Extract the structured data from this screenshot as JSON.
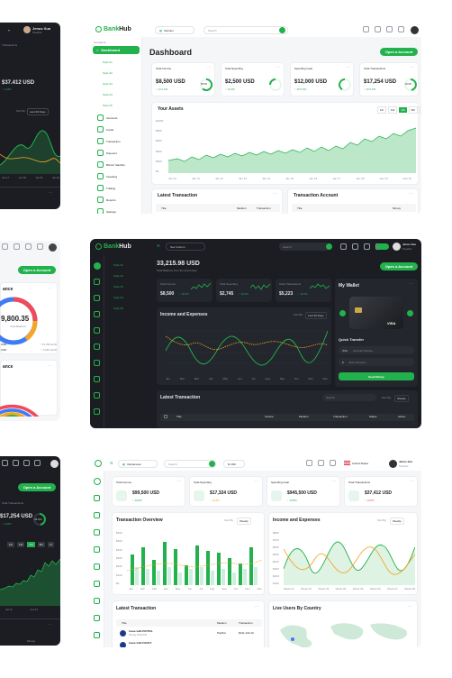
{
  "colors": {
    "accent": "#22b14c",
    "dark_bg": "#1b1d22",
    "dark_panel": "#23262c",
    "light_bg": "#f5f6f8",
    "orange": "#f5a623",
    "blue": "#3f7cf4",
    "red": "#ef4b5a"
  },
  "brand": {
    "bank": "Bank",
    "hub": "Hub"
  },
  "user": {
    "name": "Jenus Xea",
    "role": "Teacher",
    "short_name": "Jenus Xua"
  },
  "tl": {
    "amount": "$37.412 USD",
    "delta": "↑ 14.8%",
    "sort": "Sort By:",
    "sort_value": "Last 30 Days",
    "x_labels": [
      "Jul 17",
      "Jul 18",
      "Jul 19",
      "Jul 20"
    ]
  },
  "ml": {
    "open_account": "Open a Account",
    "balance_title": "ance",
    "balance_value": "9,800.35",
    "balance_caption": "Total Balance",
    "legend": [
      {
        "label": "USD",
        "value": "↑ 15,235 EUR"
      },
      {
        "label": "USD",
        "value": "↑ 14,8% EUR"
      }
    ],
    "second_title": "ance"
  },
  "bl": {
    "stat_title": "Total Transactions",
    "stat_value": "$17,254 USD",
    "stat_delta": "↑ 14.8%",
    "percent": "46.5%",
    "open_account": "Open a Account",
    "ranges": [
      "1D",
      "1W",
      "1M",
      "3M",
      "1Y"
    ],
    "x_labels": [
      "Jul 11",
      "Jul 14"
    ],
    "footer": "Money"
  },
  "d1": {
    "search_placeholder": "Search",
    "lang": "Vietnam",
    "nav_title": "Navigation",
    "nav": [
      {
        "label": "Dashboard"
      },
      {
        "label": "Style 01"
      },
      {
        "label": "Style 02"
      },
      {
        "label": "Style 03"
      },
      {
        "label": "Style 04"
      },
      {
        "label": "Style 05"
      },
      {
        "label": "Accounts"
      },
      {
        "label": "Cards"
      },
      {
        "label": "Transaction"
      },
      {
        "label": "Payment"
      },
      {
        "label": "Bitcoin Stanbits"
      },
      {
        "label": "Investing"
      },
      {
        "label": "Trading"
      },
      {
        "label": "Reports"
      },
      {
        "label": "Settings"
      }
    ],
    "title": "Dashboard",
    "open_account": "Open a Account",
    "stats": [
      {
        "title": "Total Income",
        "value": "$8,500 USD",
        "delta": "↑ 14.2 MV",
        "pct": "58.5%"
      },
      {
        "title": "Total Spending",
        "value": "$2,500 USD",
        "delta": "↑ 12 MV",
        "pct": ""
      },
      {
        "title": "Spending Goal",
        "value": "$12,000 USD",
        "delta": "↑ 15.6 MV",
        "pct": ""
      },
      {
        "title": "Total Transactions",
        "value": "$17,254 USD",
        "delta": "↑ 16.5 MV",
        "pct": "46.5%"
      }
    ],
    "assets_title": "Your Assets",
    "ranges": [
      "1D",
      "1W",
      "1M",
      "3M",
      "1Y"
    ],
    "y_labels": [
      "$1000",
      "$800",
      "$600",
      "$400",
      "$200",
      "$0"
    ],
    "x_labels": [
      "Jan 10",
      "Jan 11",
      "Jan 12",
      "Jan 13",
      "Jan 14",
      "Jan 15",
      "Jan 16",
      "Jan 17",
      "Jan 18",
      "Jan 19",
      "Feb 10"
    ],
    "latest_title": "Latest Transaction",
    "account_title": "Transaction Account",
    "cols": [
      "Title",
      "Medium",
      "Transaction"
    ],
    "cols2": [
      "Title",
      "Money"
    ]
  },
  "d2": {
    "brand_bank": "Bank",
    "brand_hub": "Hub",
    "menu": "Nav Column",
    "search": "Search",
    "nav": [
      "Style 01",
      "Style 02",
      "Style 03",
      "Style 04",
      "Style 05"
    ],
    "balance": "33,215.98 USD",
    "balance_caption": "Total Balance from the account(s)",
    "open_account": "Open a Account",
    "stats": [
      {
        "title": "Total Income",
        "value": "$8,500",
        "delta": "↑ 10.2%"
      },
      {
        "title": "Total Spending",
        "value": "$2,745",
        "delta": "↑ 10.2%"
      },
      {
        "title": "Total Transactions",
        "value": "$5,223",
        "delta": "↑ 10.2%"
      }
    ],
    "ie_title": "Income and Expenses",
    "ie_sort": "Sort By:",
    "ie_sort_value": "Last 30 Days",
    "x_labels": [
      "Jan",
      "Feb",
      "Mar",
      "Apr",
      "May",
      "Jun",
      "Jul",
      "Aug",
      "Sep",
      "Oct",
      "Nov",
      "Dec"
    ],
    "wallet_title": "My Wallet",
    "card_text": "VISA",
    "quick_title": "Quick Transfer",
    "quick_to": "Who",
    "quick_to_ph": "Account Numbe...",
    "quick_amount": "$",
    "quick_amount_ph": "Enter Amount...",
    "send": "Send Money",
    "latest_title": "Latest Transaction",
    "latest_search": "Search",
    "latest_sort": "Sort By:",
    "latest_sort_value": "Weekly",
    "cols": [
      "Title",
      "Income",
      "Medium",
      "Transaction",
      "Status",
      "Action"
    ]
  },
  "d3": {
    "lang_left": "Vietnamese",
    "search": "Search",
    "currency": "$ USD",
    "country": "United States",
    "stats": [
      {
        "title": "Total Income",
        "value": "$99,500 USD",
        "delta": "↑ 10.8%"
      },
      {
        "title": "Total Spending",
        "value": "$17,324 USD",
        "delta": "↑ 10.8%"
      },
      {
        "title": "Spending Goal",
        "value": "$945,500 USD",
        "delta": "↑ 10.8%"
      },
      {
        "title": "Total Transactions",
        "value": "$37,412 USD",
        "delta": "↑ 10.8%"
      }
    ],
    "to_title": "Transaction Overview",
    "to_sort": "Sort By:",
    "to_sort_value": "Weekly",
    "y_labels": [
      "$600",
      "$500",
      "$400",
      "$300",
      "$200",
      "$100",
      "$0"
    ],
    "to_x": [
      "Jan",
      "Feb",
      "Mar",
      "Apr",
      "May",
      "Jun",
      "Jul",
      "Aug",
      "Sep",
      "Oct",
      "Nov",
      "Dec"
    ],
    "ie_title": "Income and Expenses",
    "ie_sort": "Sort By:",
    "ie_sort_value": "Weekly",
    "ie_y": [
      "$800",
      "$700",
      "$600",
      "$500",
      "$400",
      "$300",
      "$200",
      "$100"
    ],
    "ie_x": [
      "Week 01",
      "Week 02",
      "Week 03",
      "Week 04",
      "Week 05",
      "Week 06",
      "Week 07",
      "Week 08"
    ],
    "latest_title": "Latest Transaction",
    "cols": [
      "Title",
      "Medium",
      "Transaction"
    ],
    "rows": [
      {
        "title": "Issue with PAYPAL",
        "date": "02 Aug, 05:56 PM",
        "medium": "PayPal",
        "tx": "$131,134.10"
      },
      {
        "title": "Issue with FACET",
        "date": "",
        "medium": "",
        "tx": ""
      }
    ],
    "live_title": "Live Users By Country"
  }
}
